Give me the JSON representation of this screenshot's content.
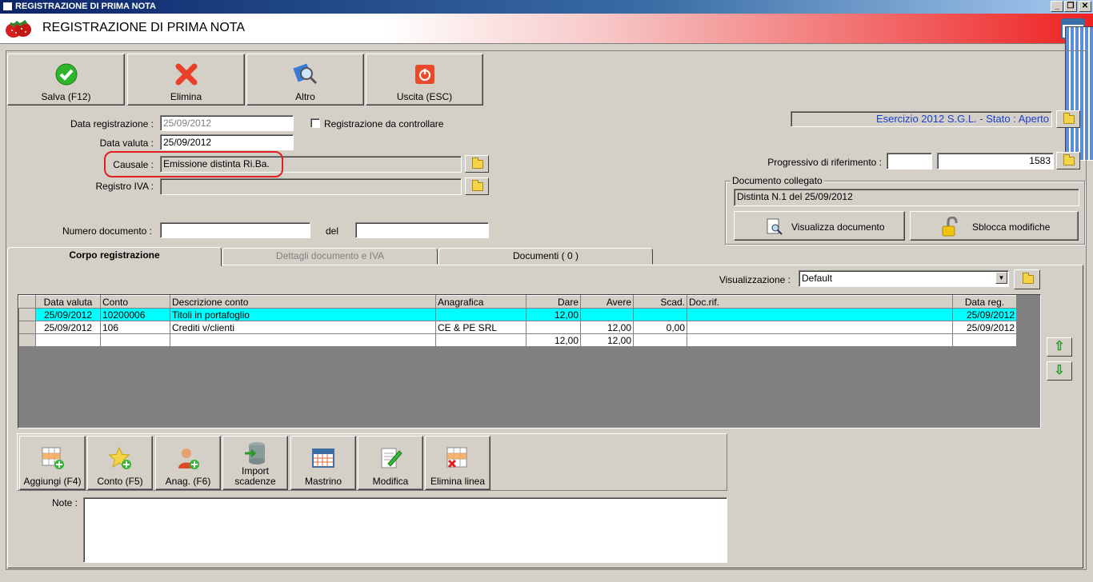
{
  "window": {
    "title": "REGISTRAZIONE DI PRIMA NOTA",
    "minimize": "_",
    "restore": "❐",
    "close": "✕"
  },
  "header": {
    "title": "REGISTRAZIONE DI PRIMA NOTA"
  },
  "toolbar": {
    "save": "Salva (F12)",
    "delete": "Elimina",
    "other": "Altro",
    "exit": "Uscita (ESC)"
  },
  "form": {
    "data_registrazione_label": "Data registrazione :",
    "data_registrazione_value": "25/09/2012",
    "da_controllare_label": "Registrazione da controllare",
    "data_valuta_label": "Data valuta :",
    "data_valuta_value": "25/09/2012",
    "causale_label": "Causale :",
    "causale_value": "Emissione distinta Ri.Ba.",
    "registro_iva_label": "Registro IVA :",
    "registro_iva_value": "",
    "numero_documento_label": "Numero documento :",
    "numero_documento_value": "",
    "del_label": "del",
    "del_value": ""
  },
  "right": {
    "esercizio": "Esercizio 2012 S.G.L. - Stato : Aperto",
    "progressivo_label": "Progressivo di riferimento :",
    "progressivo_a": "",
    "progressivo_b": "1583",
    "documento_collegato_title": "Documento collegato",
    "documento_collegato_value": "Distinta N.1 del 25/09/2012",
    "visualizza_documento": "Visualizza documento",
    "sblocca_modifiche": "Sblocca modifiche"
  },
  "tabs": [
    {
      "label": "Corpo registrazione"
    },
    {
      "label": "Dettagli documento e IVA"
    },
    {
      "label": "Documenti ( 0 )"
    }
  ],
  "view": {
    "label": "Visualizzazione :",
    "selected": "Default"
  },
  "grid": {
    "columns": [
      "Data valuta",
      "Conto",
      "Descrizione conto",
      "Anagrafica",
      "Dare",
      "Avere",
      "Scad.",
      "Doc.rif.",
      "Data reg."
    ],
    "rows": [
      [
        "25/09/2012",
        "10200006",
        "Titoli in portafoglio",
        "",
        "12,00",
        "",
        "",
        "",
        "25/09/2012"
      ],
      [
        "25/09/2012",
        "106",
        "Crediti v/clienti",
        "CE & PE SRL",
        "",
        "12,00",
        "0,00",
        "",
        "25/09/2012"
      ],
      [
        "",
        "",
        "",
        "",
        "12,00",
        "12,00",
        "",
        "",
        ""
      ]
    ]
  },
  "actions": {
    "aggiungi": "Aggiungi (F4)",
    "conto": "Conto (F5)",
    "anag": "Anag. (F6)",
    "import_1": "Import",
    "import_2": "scadenze",
    "mastrino": "Mastrino",
    "modifica": "Modifica",
    "elimina_linea": "Elimina linea"
  },
  "note": {
    "label": "Note :",
    "value": ""
  },
  "colors": {
    "selected_row": "#00ffff",
    "window_bg": "#d4d0c8",
    "title_blue": "#0a246a",
    "highlight_circle": "#e02020"
  },
  "icons": [
    "check-icon",
    "delete-x-icon",
    "search-icon",
    "power-icon",
    "folder-icon",
    "lock-icon",
    "arrow-up-icon",
    "arrow-down-icon",
    "calendar-icon",
    "strawberry-icon"
  ]
}
